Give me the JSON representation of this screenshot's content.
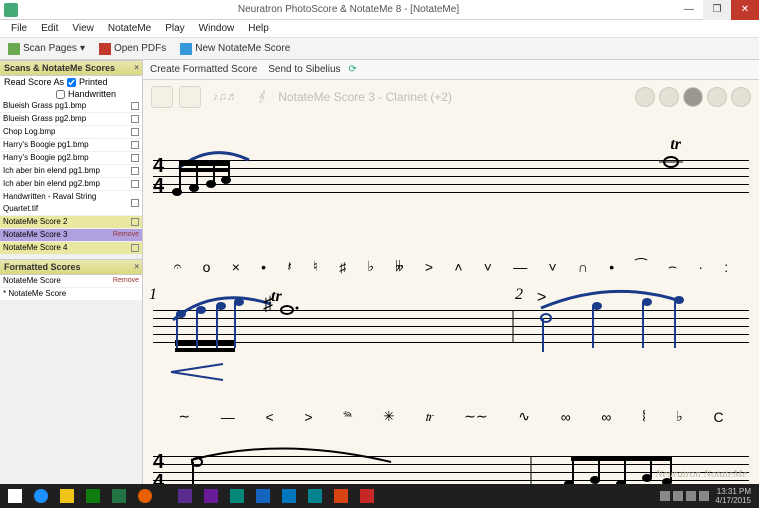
{
  "titlebar": {
    "title": "Neuratron PhotoScore & NotateMe 8 - [NotateMe]"
  },
  "menu": [
    "File",
    "Edit",
    "View",
    "NotateMe",
    "Play",
    "Window",
    "Help"
  ],
  "toolbar": {
    "scan_pages": "Scan Pages",
    "open_pdfs": "Open PDFs",
    "new_score": "New NotateMe Score"
  },
  "toolbar2": {
    "create_formatted": "Create Formatted Score",
    "send_sibelius": "Send to Sibelius"
  },
  "sidebar": {
    "panel1_header": "Scans & NotateMe Scores",
    "read_as_label": "Read Score As",
    "printed_label": "Printed",
    "handwritten_label": "Handwritten",
    "files": [
      {
        "name": "Blueish Grass pg1.bmp",
        "sel": false
      },
      {
        "name": "Blueish Grass pg2.bmp",
        "sel": false
      },
      {
        "name": "Chop Log.bmp",
        "sel": false
      },
      {
        "name": "Harry's Boogie pg1.bmp",
        "sel": false
      },
      {
        "name": "Harry's Boogie pg2.bmp",
        "sel": false
      },
      {
        "name": "Ich aber bin elend pg1.bmp",
        "sel": false
      },
      {
        "name": "Ich aber bin elend pg2.bmp",
        "sel": false
      },
      {
        "name": "Handwritten - Raval String Quartet.tif",
        "sel": false
      },
      {
        "name": "NotateMe Score 2",
        "sel": false,
        "hl": true
      },
      {
        "name": "NotateMe Score 3",
        "sel": true,
        "remove": "Remove"
      },
      {
        "name": "NotateMe Score 4",
        "sel": false,
        "hl": true
      }
    ],
    "panel2_header": "Formatted Scores",
    "formatted": [
      {
        "name": "NotateMe Score",
        "remove": "Remove"
      },
      {
        "name": "* NotateMe Score"
      }
    ]
  },
  "score": {
    "title": "NotateMe Score 3 - Clarinet (+2)",
    "tr": "tr",
    "bar1": "1",
    "bar2": "2",
    "timesig_top": "4",
    "timesig_bot": "4",
    "symbols_row1": [
      "𝄐",
      "o",
      "×",
      "•",
      "𝄽",
      "♮",
      "♯",
      "♭",
      "𝄫",
      ">",
      "˄",
      "˅",
      "—",
      "˅",
      "∩",
      "•",
      "⁀",
      "⌢",
      "·",
      ":"
    ],
    "symbols_row2": [
      "∼",
      "—",
      "<",
      ">",
      "𝆮",
      "✳",
      "𝆖",
      "∼∼",
      "∿",
      "∞",
      "∞",
      "𝄔",
      "♭",
      "C"
    ]
  },
  "watermark": "Neuratron NotateMe",
  "taskbar": {
    "time": "13:31 PM",
    "date": "4/17/2015"
  }
}
